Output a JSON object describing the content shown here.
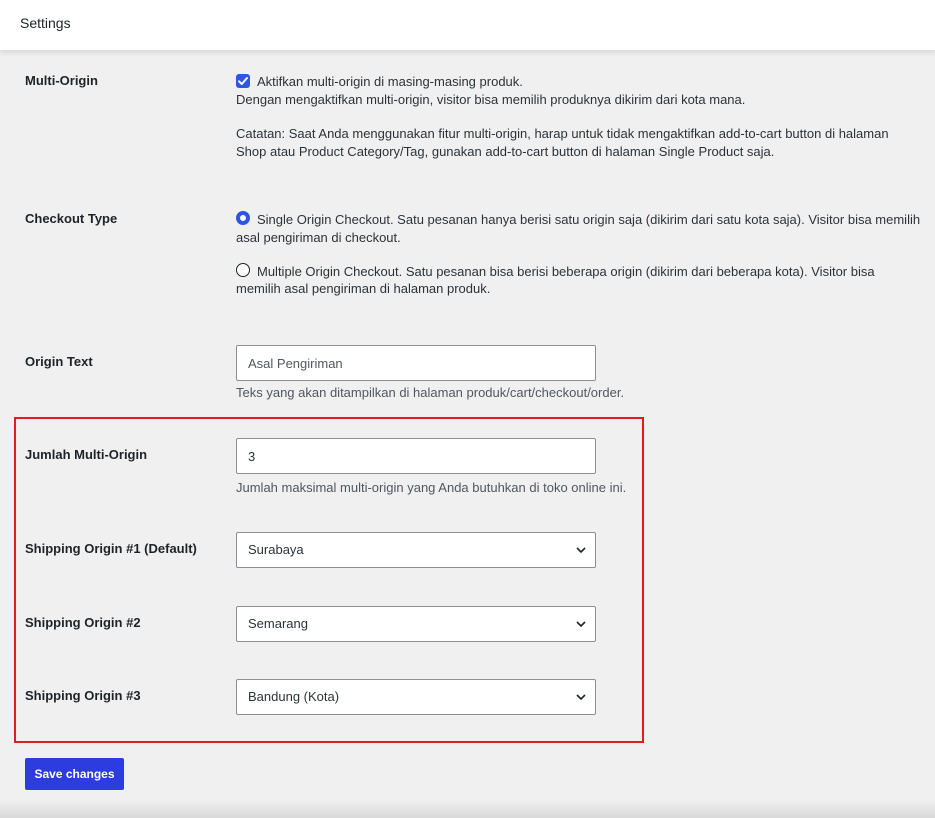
{
  "header": {
    "title": "Settings"
  },
  "multi_origin": {
    "label": "Multi-Origin",
    "checkbox_label": "Aktifkan multi-origin di masing-masing produk.",
    "checked": true,
    "desc1": "Dengan mengaktifkan multi-origin, visitor bisa memilih produknya dikirim dari kota mana.",
    "note_line1": "Catatan: Saat Anda menggunakan fitur multi-origin, harap untuk tidak mengaktifkan add-to-cart button di halaman",
    "note_line2": "Shop atau Product Category/Tag, gunakan add-to-cart button di halaman Single Product saja."
  },
  "checkout_type": {
    "label": "Checkout Type",
    "options": [
      {
        "line1": "Single Origin Checkout. Satu pesanan hanya berisi satu origin saja (dikirim dari satu kota saja). Visitor bisa memilih",
        "line2": "asal pengiriman di checkout.",
        "selected": true
      },
      {
        "line1": "Multiple Origin Checkout. Satu pesanan bisa berisi beberapa origin (dikirim dari beberapa kota). Visitor bisa",
        "line2": "memilih asal pengiriman di halaman produk.",
        "selected": false
      }
    ]
  },
  "origin_text": {
    "label": "Origin Text",
    "placeholder": "Asal Pengiriman",
    "desc": "Teks yang akan ditampilkan di halaman produk/cart/checkout/order."
  },
  "jumlah": {
    "label": "Jumlah Multi-Origin",
    "value": "3",
    "desc": "Jumlah maksimal multi-origin yang Anda butuhkan di toko online ini."
  },
  "origins": [
    {
      "label": "Shipping Origin #1 (Default)",
      "value": "Surabaya"
    },
    {
      "label": "Shipping Origin #2",
      "value": "Semarang"
    },
    {
      "label": "Shipping Origin #3",
      "value": "Bandung (Kota)"
    }
  ],
  "save_label": "Save changes",
  "colors": {
    "accent": "#2c58e0",
    "highlight": "#e21c1c",
    "button": "#2c3ce0"
  }
}
